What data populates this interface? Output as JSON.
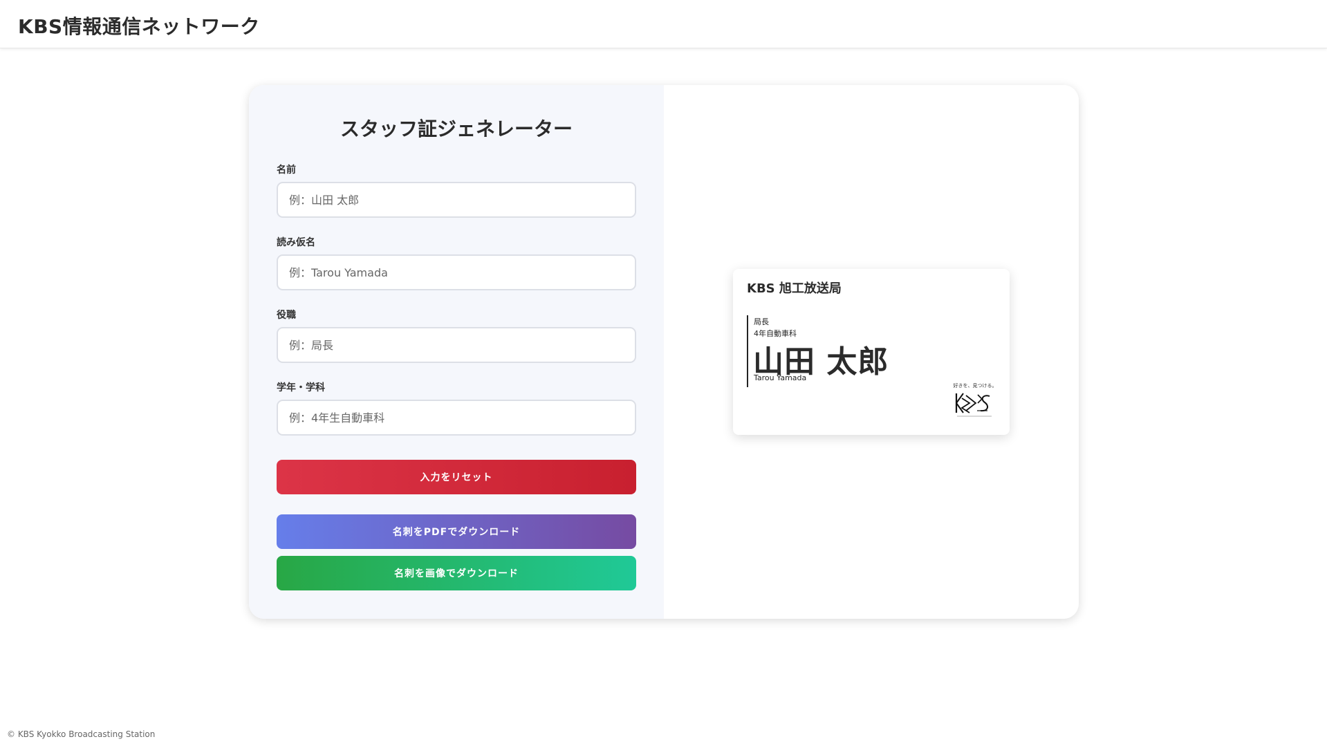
{
  "header": {
    "title": "KBS情報通信ネットワーク"
  },
  "form": {
    "title": "スタッフ証ジェネレーター",
    "fields": [
      {
        "label": "名前",
        "placeholder": "例：山田 太郎",
        "value": ""
      },
      {
        "label": "読み仮名",
        "placeholder": "例：Tarou Yamada",
        "value": ""
      },
      {
        "label": "役職",
        "placeholder": "例：局長",
        "value": ""
      },
      {
        "label": "学年・学科",
        "placeholder": "例：4年生自動車科",
        "value": ""
      }
    ],
    "buttons": {
      "reset": "入力をリセット",
      "pdf": "名刺をPDFでダウンロード",
      "image": "名刺を画像でダウンロード"
    }
  },
  "card": {
    "station": "KBS 旭工放送局",
    "position": "局長",
    "department": "4年自動車科",
    "name": "山田 太郎",
    "reading": "Tarou Yamada",
    "logo_tagline": "好きを、見つける。",
    "logo_text": "KBS",
    "logo_subtitle": "Kyokko Broadcasting Station"
  },
  "footer": {
    "text": "© KBS Kyokko Broadcasting Station"
  },
  "colors": {
    "reset_button": "#dc3447",
    "pdf_button_start": "#667eea",
    "pdf_button_end": "#764ba2",
    "image_button_start": "#28a745",
    "image_button_end": "#20c997",
    "form_background": "#f5f7fc"
  }
}
